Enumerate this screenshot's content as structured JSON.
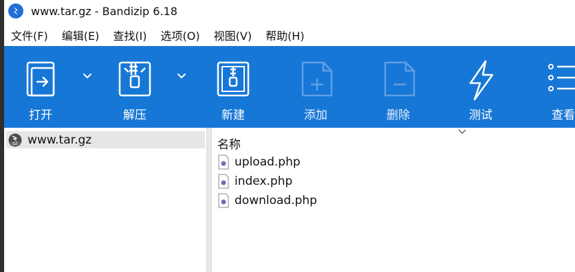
{
  "window": {
    "title": "www.tar.gz - Bandizip 6.18",
    "app_icon": "bandizip-logo-icon",
    "accent_color": "#1777d6"
  },
  "menu": [
    "文件(F)",
    "编辑(E)",
    "查找(I)",
    "选项(O)",
    "视图(V)",
    "帮助(H)"
  ],
  "toolbar": {
    "open": "打开",
    "extract": "解压",
    "new": "新建",
    "add": "添加",
    "delete": "删除",
    "test": "测试",
    "view": "查看"
  },
  "tree": {
    "archive": "www.tar.gz",
    "archive_icon": "gz-archive-icon"
  },
  "filelist": {
    "column_name": "名称",
    "files": [
      "upload.php",
      "index.php",
      "download.php"
    ]
  }
}
